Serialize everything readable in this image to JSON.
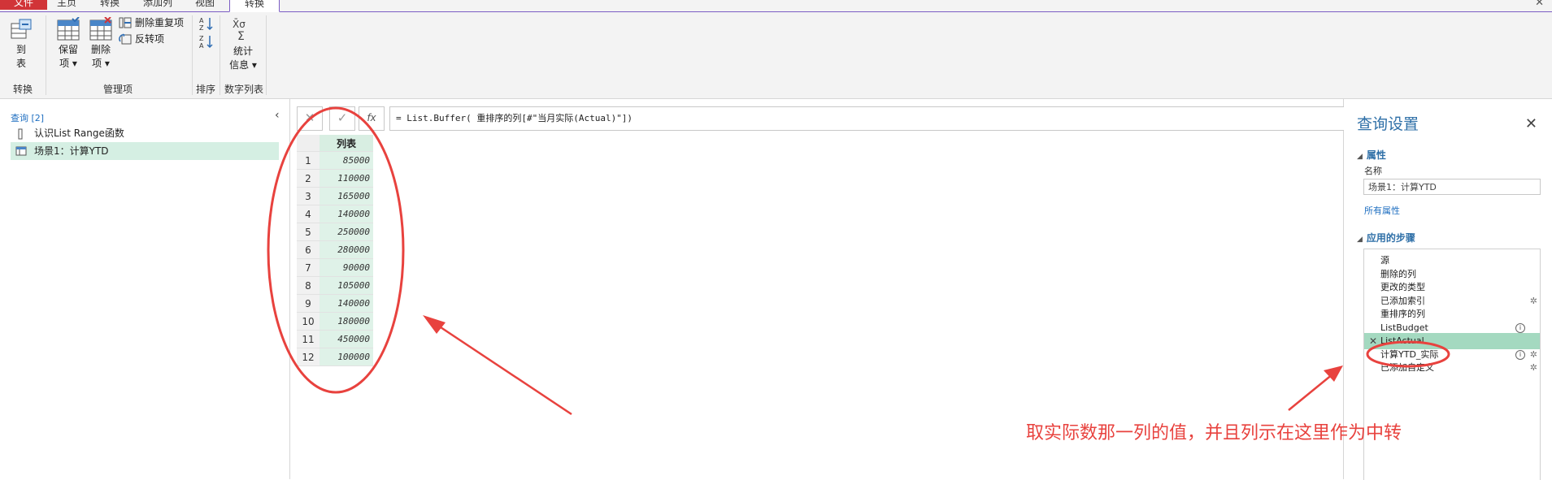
{
  "tabs": {
    "file": "文件",
    "home": "主页",
    "transform": "转换",
    "add_column": "添加列",
    "view": "视图",
    "active": "转换"
  },
  "ribbon": {
    "to_table": [
      "到",
      "表"
    ],
    "keep_rows": [
      "保留",
      "项"
    ],
    "remove_rows": [
      "删除",
      "项"
    ],
    "remove_duplicates": "删除重复项",
    "reverse_rows": "反转项",
    "statistics": [
      "统计",
      "信息"
    ],
    "groups": {
      "convert": "转换",
      "manage": "管理项",
      "sort": "排序",
      "numeric_list": "数字列表"
    }
  },
  "queries": {
    "header": "查询 [2]",
    "items": [
      {
        "label": "认识List Range函数",
        "icon": "list-query-icon"
      },
      {
        "label": "场景1：计算YTD",
        "icon": "table-query-icon"
      }
    ]
  },
  "formula_bar": {
    "cancel": "✕",
    "confirm": "✓",
    "fx": "fx",
    "text": "= List.Buffer( 重排序的列[#\"当月实际(Actual)\"])"
  },
  "grid": {
    "header": "列表",
    "rows": [
      {
        "n": "1",
        "v": "85000"
      },
      {
        "n": "2",
        "v": "110000"
      },
      {
        "n": "3",
        "v": "165000"
      },
      {
        "n": "4",
        "v": "140000"
      },
      {
        "n": "5",
        "v": "250000"
      },
      {
        "n": "6",
        "v": "280000"
      },
      {
        "n": "7",
        "v": "90000"
      },
      {
        "n": "8",
        "v": "105000"
      },
      {
        "n": "9",
        "v": "140000"
      },
      {
        "n": "10",
        "v": "180000"
      },
      {
        "n": "11",
        "v": "450000"
      },
      {
        "n": "12",
        "v": "100000"
      }
    ]
  },
  "settings": {
    "title": "查询设置",
    "properties": "属性",
    "name_label": "名称",
    "name_value": "场景1：计算YTD",
    "all_properties": "所有属性",
    "applied_steps": "应用的步骤",
    "steps": [
      {
        "label": "源",
        "info": false,
        "gear": false,
        "selected": false
      },
      {
        "label": "删除的列",
        "info": false,
        "gear": false,
        "selected": false
      },
      {
        "label": "更改的类型",
        "info": false,
        "gear": false,
        "selected": false
      },
      {
        "label": "已添加索引",
        "info": false,
        "gear": true,
        "selected": false
      },
      {
        "label": "重排序的列",
        "info": false,
        "gear": false,
        "selected": false
      },
      {
        "label": "ListBudget",
        "info": true,
        "gear": false,
        "selected": false
      },
      {
        "label": "ListActual",
        "info": false,
        "gear": false,
        "selected": true
      },
      {
        "label": "计算YTD_实际",
        "info": true,
        "gear": true,
        "selected": false
      },
      {
        "label": "已添加自定义",
        "info": false,
        "gear": true,
        "selected": false
      }
    ]
  },
  "annotation": {
    "text": "取实际数那一列的值，并且列示在这里作为中转",
    "color": "#e8423e"
  }
}
